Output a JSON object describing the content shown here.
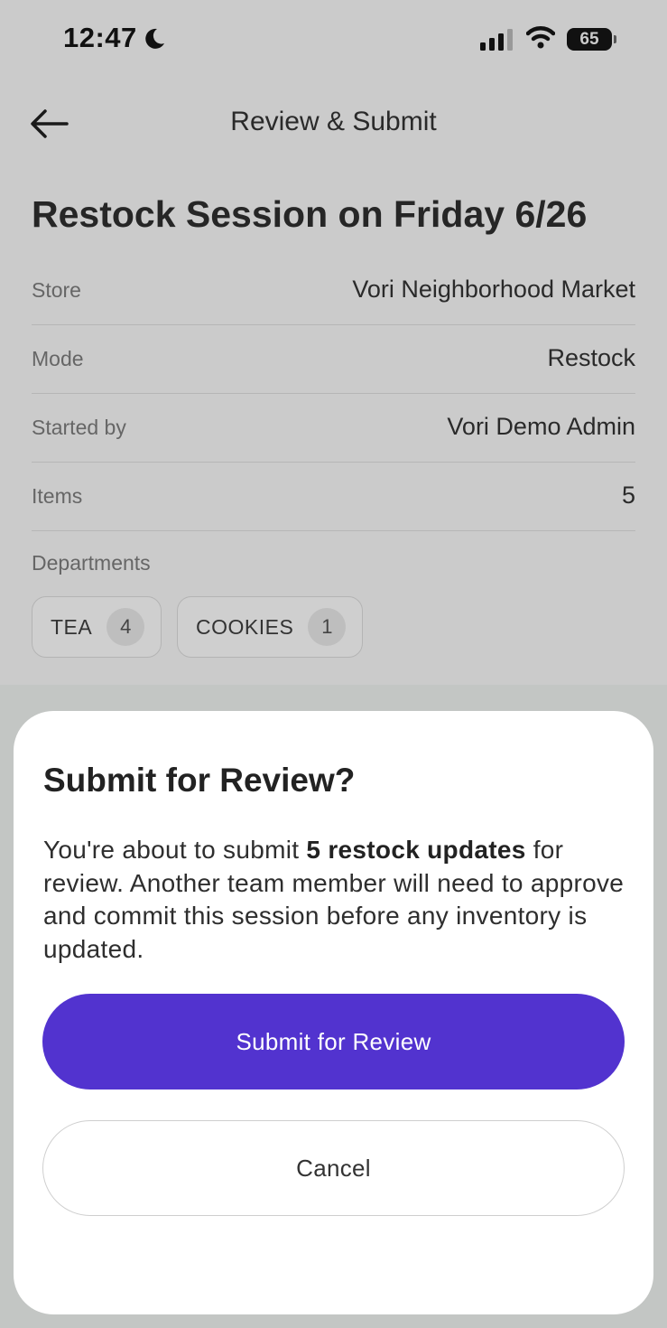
{
  "status_bar": {
    "time": "12:47",
    "focus_icon": "moon-icon",
    "signal_icon": "cellular-signal-icon",
    "wifi_icon": "wifi-icon",
    "battery_level": "65"
  },
  "nav": {
    "back_icon": "arrow-left-icon",
    "title": "Review & Submit"
  },
  "session": {
    "title": "Restock Session on Friday 6/26",
    "details": [
      {
        "label": "Store",
        "value": "Vori Neighborhood Market"
      },
      {
        "label": "Mode",
        "value": "Restock"
      },
      {
        "label": "Started by",
        "value": "Vori Demo Admin"
      },
      {
        "label": "Items",
        "value": "5"
      }
    ],
    "departments_label": "Departments",
    "departments": [
      {
        "name": "TEA",
        "count": "4"
      },
      {
        "name": "COOKIES",
        "count": "1"
      }
    ]
  },
  "dialog": {
    "title": "Submit for Review?",
    "body_before": "You're about to submit ",
    "body_bold": "5 restock updates",
    "body_after": " for review. Another team member will need to approve and commit this session before any inventory is updated.",
    "submit_label": "Submit for Review",
    "cancel_label": "Cancel"
  },
  "colors": {
    "primary": "#5233cf",
    "overlay": "#cbcbcb",
    "sheet": "#ffffff"
  }
}
